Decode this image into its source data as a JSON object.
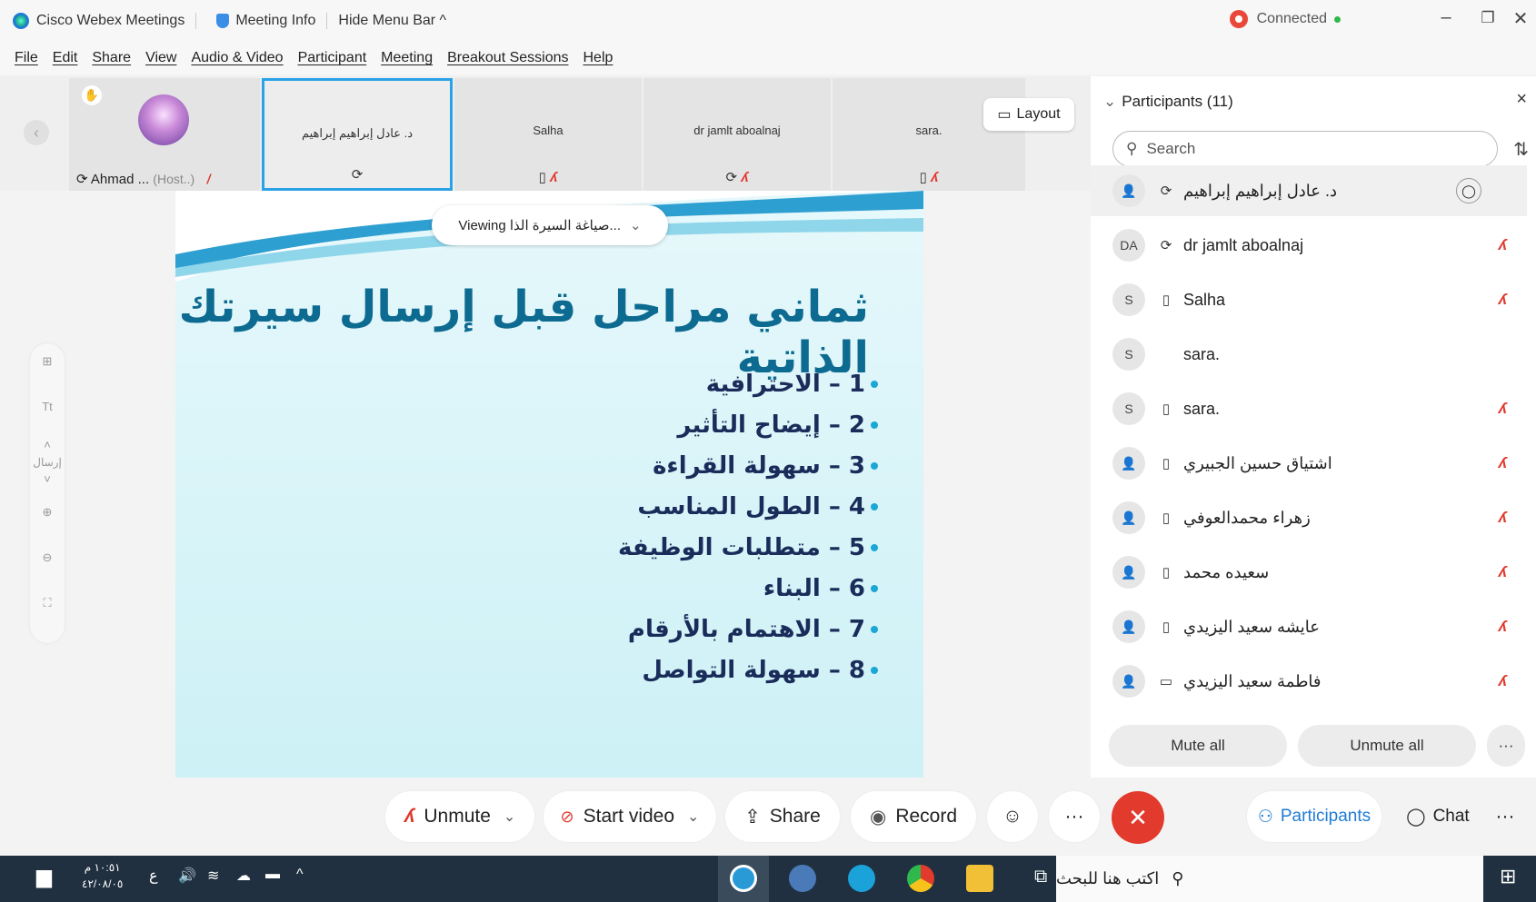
{
  "titlebar": {
    "app_name": "Cisco Webex Meetings",
    "meeting_info": "Meeting Info",
    "hide_menu": "Hide Menu Bar ^",
    "status": "Connected"
  },
  "menu": [
    "File",
    "Edit",
    "Share",
    "View",
    "Audio & Video",
    "Participant",
    "Meeting",
    "Breakout Sessions",
    "Help"
  ],
  "strip": {
    "host_name": "Ahmad ...",
    "host_tag": "(Host..)",
    "tiles": [
      "د. عادل إبراهيم إبراهيم",
      "Salha",
      "dr jamlt aboalnaj",
      "sara."
    ],
    "layout_label": "Layout"
  },
  "share": {
    "viewing_label": "Viewing صياغة السيرة الذا...",
    "title": "ثماني مراحل قبل إرسال سيرتك الذاتية",
    "bullets": [
      "1 – الاحترافية",
      "2 – إيضاح التأثير",
      "3 – سهولة القراءة",
      "4 – الطول المناسب",
      "5 – متطلبات الوظيفة",
      "6 – البناء",
      "7 – الاهتمام بالأرقام",
      "8 – سهولة التواصل"
    ]
  },
  "zoombar": {
    "send_label": "إرسال"
  },
  "panel": {
    "title": "Participants (11)",
    "search_placeholder": "Search",
    "participants": [
      {
        "initials": "",
        "name": "د. عادل إبراهيم إبراهيم",
        "muted": false
      },
      {
        "initials": "DA",
        "name": "dr jamlt aboalnaj",
        "muted": true
      },
      {
        "initials": "S",
        "name": "Salha",
        "muted": true
      },
      {
        "initials": "S",
        "name": "sara.",
        "muted": false
      },
      {
        "initials": "S",
        "name": "sara.",
        "muted": true
      },
      {
        "initials": "",
        "name": "اشتياق حسين الجبيري",
        "muted": true
      },
      {
        "initials": "",
        "name": "زهراء محمدالعوفي",
        "muted": true
      },
      {
        "initials": "",
        "name": "سعيده محمد",
        "muted": true
      },
      {
        "initials": "",
        "name": "عايشه سعيد اليزيدي",
        "muted": true
      },
      {
        "initials": "",
        "name": "فاطمة سعيد اليزيدي",
        "muted": true
      }
    ],
    "mute_all": "Mute all",
    "unmute_all": "Unmute all"
  },
  "toolbar": {
    "unmute": "Unmute",
    "start_video": "Start video",
    "share": "Share",
    "record": "Record",
    "participants": "Participants",
    "chat": "Chat"
  },
  "taskbar": {
    "search_placeholder": "اكتب هنا للبحث",
    "time": "١٠:٥١ م",
    "date": "٤٢/٠٨/٠٥",
    "lang": "ع"
  },
  "colors": {
    "accent": "#1f7bd4",
    "danger": "#e23a2c",
    "slide_title": "#0d6a90"
  }
}
